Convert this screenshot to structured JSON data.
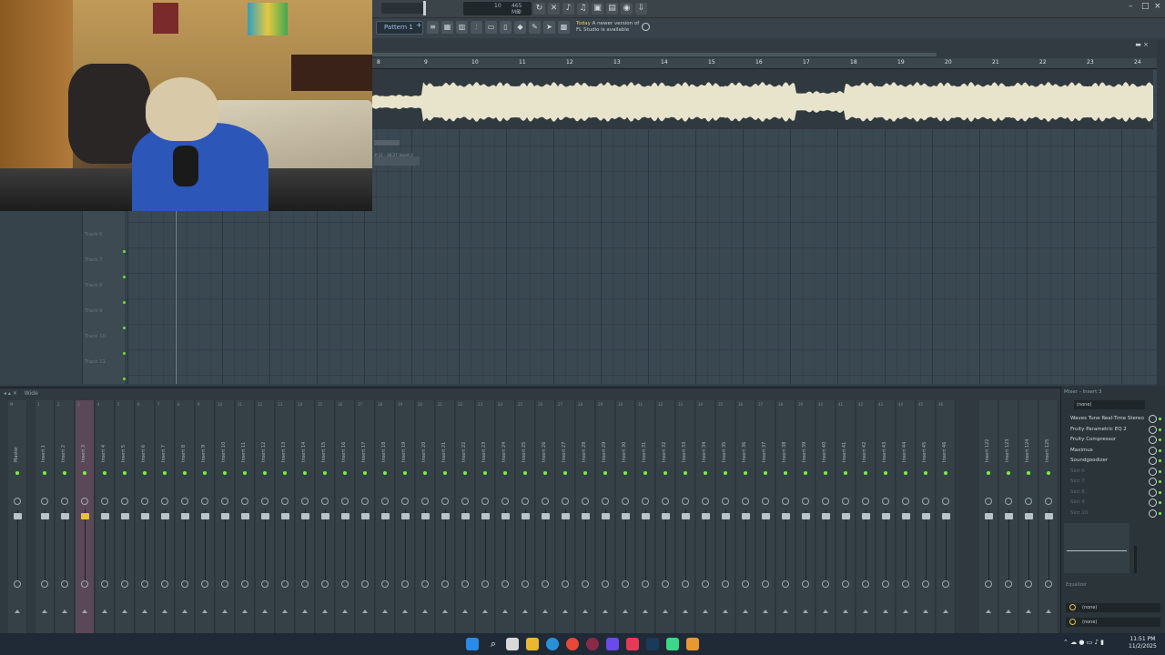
{
  "app": {
    "pattern_selector": "Pattern 1",
    "cpu": {
      "value": "10",
      "mem": "465 MB",
      "poly": "0"
    },
    "news_title": "Today",
    "news_text_1": "A newer version of",
    "news_text_2": "FL Studio is available"
  },
  "playlist": {
    "ruler": [
      "8",
      "9",
      "10",
      "11",
      "12",
      "13",
      "14",
      "15",
      "16",
      "17",
      "18",
      "19",
      "20",
      "21",
      "22",
      "23",
      "24"
    ],
    "tracks": [
      "Track 6",
      "Track 7",
      "Track 8",
      "Track 9",
      "Track 10",
      "Track 11"
    ],
    "clip2_label": "#-11 - 18-37_Insert 2"
  },
  "mixer": {
    "title": "Wide",
    "strips": [
      "Master",
      "Insert 1",
      "Insert 2",
      "Insert 3",
      "Insert 4",
      "Insert 5",
      "Insert 6",
      "Insert 7",
      "Insert 8",
      "Insert 9",
      "Insert 10",
      "Insert 11",
      "Insert 12",
      "Insert 13",
      "Insert 14",
      "Insert 15",
      "Insert 16",
      "Insert 17",
      "Insert 18",
      "Insert 19",
      "Insert 20",
      "Insert 21",
      "Insert 22",
      "Insert 23",
      "Insert 24",
      "Insert 25",
      "Insert 26",
      "Insert 27",
      "Insert 28",
      "Insert 29",
      "Insert 30",
      "Insert 31",
      "Insert 32",
      "Insert 33",
      "Insert 34",
      "Insert 35",
      "Insert 36",
      "Insert 37",
      "Insert 38",
      "Insert 39",
      "Insert 40",
      "Insert 41",
      "Insert 42",
      "Insert 43",
      "Insert 44",
      "Insert 45",
      "Insert 46"
    ],
    "right_strips": [
      "Insert 122",
      "Insert 123",
      "Insert 124",
      "Insert 125"
    ],
    "panel_title": "Mixer - Insert 3",
    "preset": "(none)",
    "fx_slots": [
      "Waves Tune Real-Time Stereo",
      "Fruity Parametric EQ 2",
      "Fruity Compressor",
      "Maximus",
      "Soundgoodizer",
      "Slot 6",
      "Slot 7",
      "Slot 8",
      "Slot 9",
      "Slot 10"
    ],
    "eq_label": "Equalizer",
    "out_1": "(none)",
    "out_2": "(none)"
  },
  "taskbar": {
    "time": "11:51 PM",
    "date": "11/2/2025"
  },
  "colors": {
    "accent": "#7af040",
    "waveform": "#e8e4cc",
    "selected_strip": "#5a4858"
  }
}
